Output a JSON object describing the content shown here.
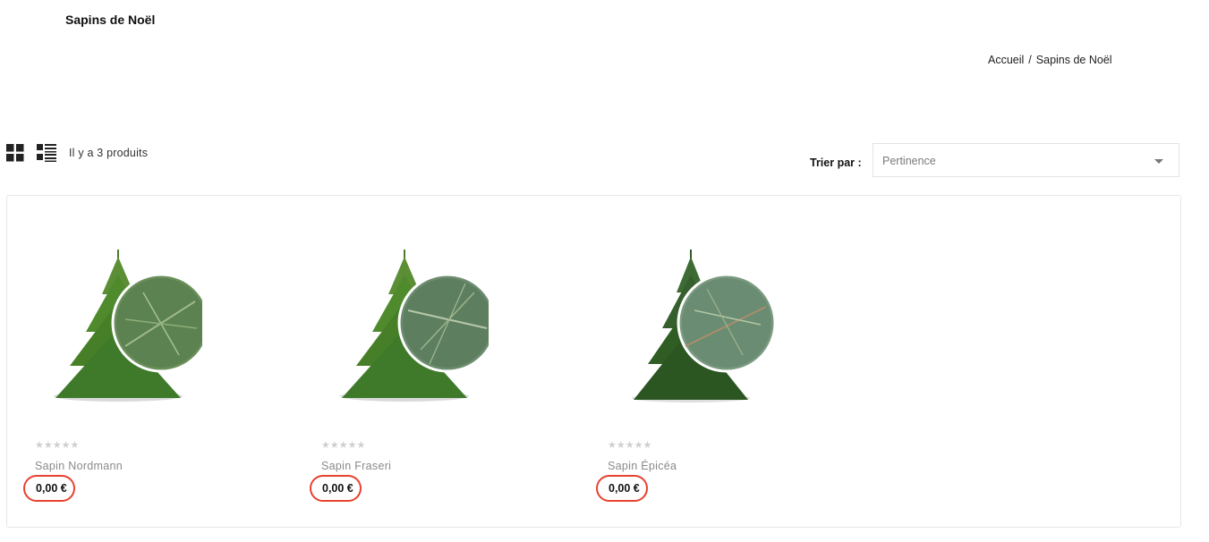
{
  "page": {
    "title": "Sapins de Noël"
  },
  "breadcrumb": {
    "home": "Accueil",
    "separator": "/",
    "current": "Sapins de Noël"
  },
  "toolbar": {
    "grid_icon": "grid-view-icon",
    "list_icon": "list-view-icon",
    "product_count": "Il y a 3 produits",
    "sort_label": "Trier par :",
    "sort_value": "Pertinence"
  },
  "products": [
    {
      "name": "Sapin Nordmann",
      "price": "0,00 €",
      "stars": "★★★★★",
      "rating": 0
    },
    {
      "name": "Sapin Fraseri",
      "price": "0,00 €",
      "stars": "★★★★★",
      "rating": 0
    },
    {
      "name": "Sapin Épicéa",
      "price": "0,00 €",
      "stars": "★★★★★",
      "rating": 0
    }
  ],
  "colors": {
    "price_highlight": "#e8412f",
    "tree_green": "#3f7a2a",
    "tree_dark": "#2f5d24",
    "star_empty": "#cfcfcf"
  }
}
